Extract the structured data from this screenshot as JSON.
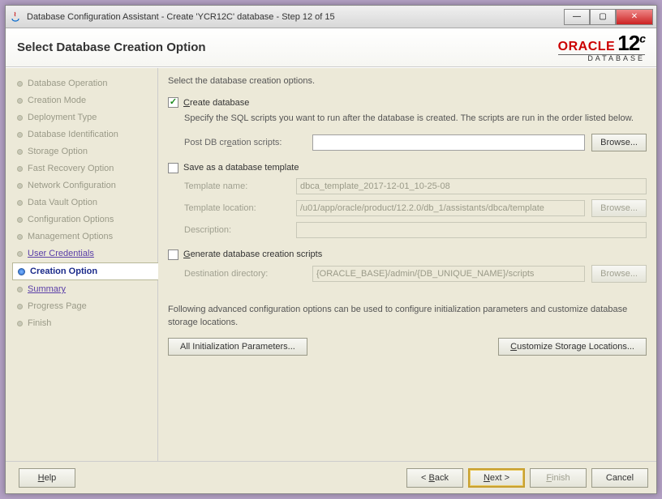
{
  "window": {
    "title": "Database Configuration Assistant - Create 'YCR12C' database - Step 12 of 15"
  },
  "header": {
    "title": "Select Database Creation Option",
    "brand": "ORACLE",
    "product": "DATABASE",
    "version_major": "12",
    "version_suffix": "c"
  },
  "nav": {
    "items": [
      {
        "label": "Database Operation",
        "state": "done"
      },
      {
        "label": "Creation Mode",
        "state": "done"
      },
      {
        "label": "Deployment Type",
        "state": "done"
      },
      {
        "label": "Database Identification",
        "state": "done"
      },
      {
        "label": "Storage Option",
        "state": "done"
      },
      {
        "label": "Fast Recovery Option",
        "state": "done"
      },
      {
        "label": "Network Configuration",
        "state": "done"
      },
      {
        "label": "Data Vault Option",
        "state": "done"
      },
      {
        "label": "Configuration Options",
        "state": "done"
      },
      {
        "label": "Management Options",
        "state": "done"
      },
      {
        "label": "User Credentials",
        "state": "link"
      },
      {
        "label": "Creation Option",
        "state": "current"
      },
      {
        "label": "Summary",
        "state": "link"
      },
      {
        "label": "Progress Page",
        "state": "pending"
      },
      {
        "label": "Finish",
        "state": "pending"
      }
    ]
  },
  "content": {
    "intro": "Select the database creation options.",
    "create_db": {
      "checked": true,
      "label_pre": "C",
      "label_rest": "reate database",
      "desc": "Specify the SQL scripts you want to run after the database is created. The scripts are run in the order listed below.",
      "scripts_label_pre": "Post DB cr",
      "scripts_label_u": "e",
      "scripts_label_post": "ation scripts:",
      "scripts_value": "",
      "browse": "Browse..."
    },
    "save_template": {
      "checked": false,
      "label": "Save as a database template",
      "name_label": "Template name:",
      "name_value": "dbca_template_2017-12-01_10-25-08",
      "location_label": "Template location:",
      "location_value": "/u01/app/oracle/product/12.2.0/db_1/assistants/dbca/template",
      "browse": "Browse...",
      "desc_label": "Description:",
      "desc_value": ""
    },
    "gen_scripts": {
      "checked": false,
      "label_pre": "G",
      "label_rest": "enerate database creation scripts",
      "dest_label": "Destination directory:",
      "dest_value": "{ORACLE_BASE}/admin/{DB_UNIQUE_NAME}/scripts",
      "browse": "Browse..."
    },
    "adv": {
      "desc": "Following advanced configuration options can be used to configure initialization parameters and customize database storage locations.",
      "init_btn": "All Initialization Parameters...",
      "storage_btn_pre": "C",
      "storage_btn_rest": "ustomize Storage Locations..."
    }
  },
  "footer": {
    "help": "Help",
    "back": "Back",
    "next": "Next",
    "finish": "Finish",
    "cancel": "Cancel"
  }
}
